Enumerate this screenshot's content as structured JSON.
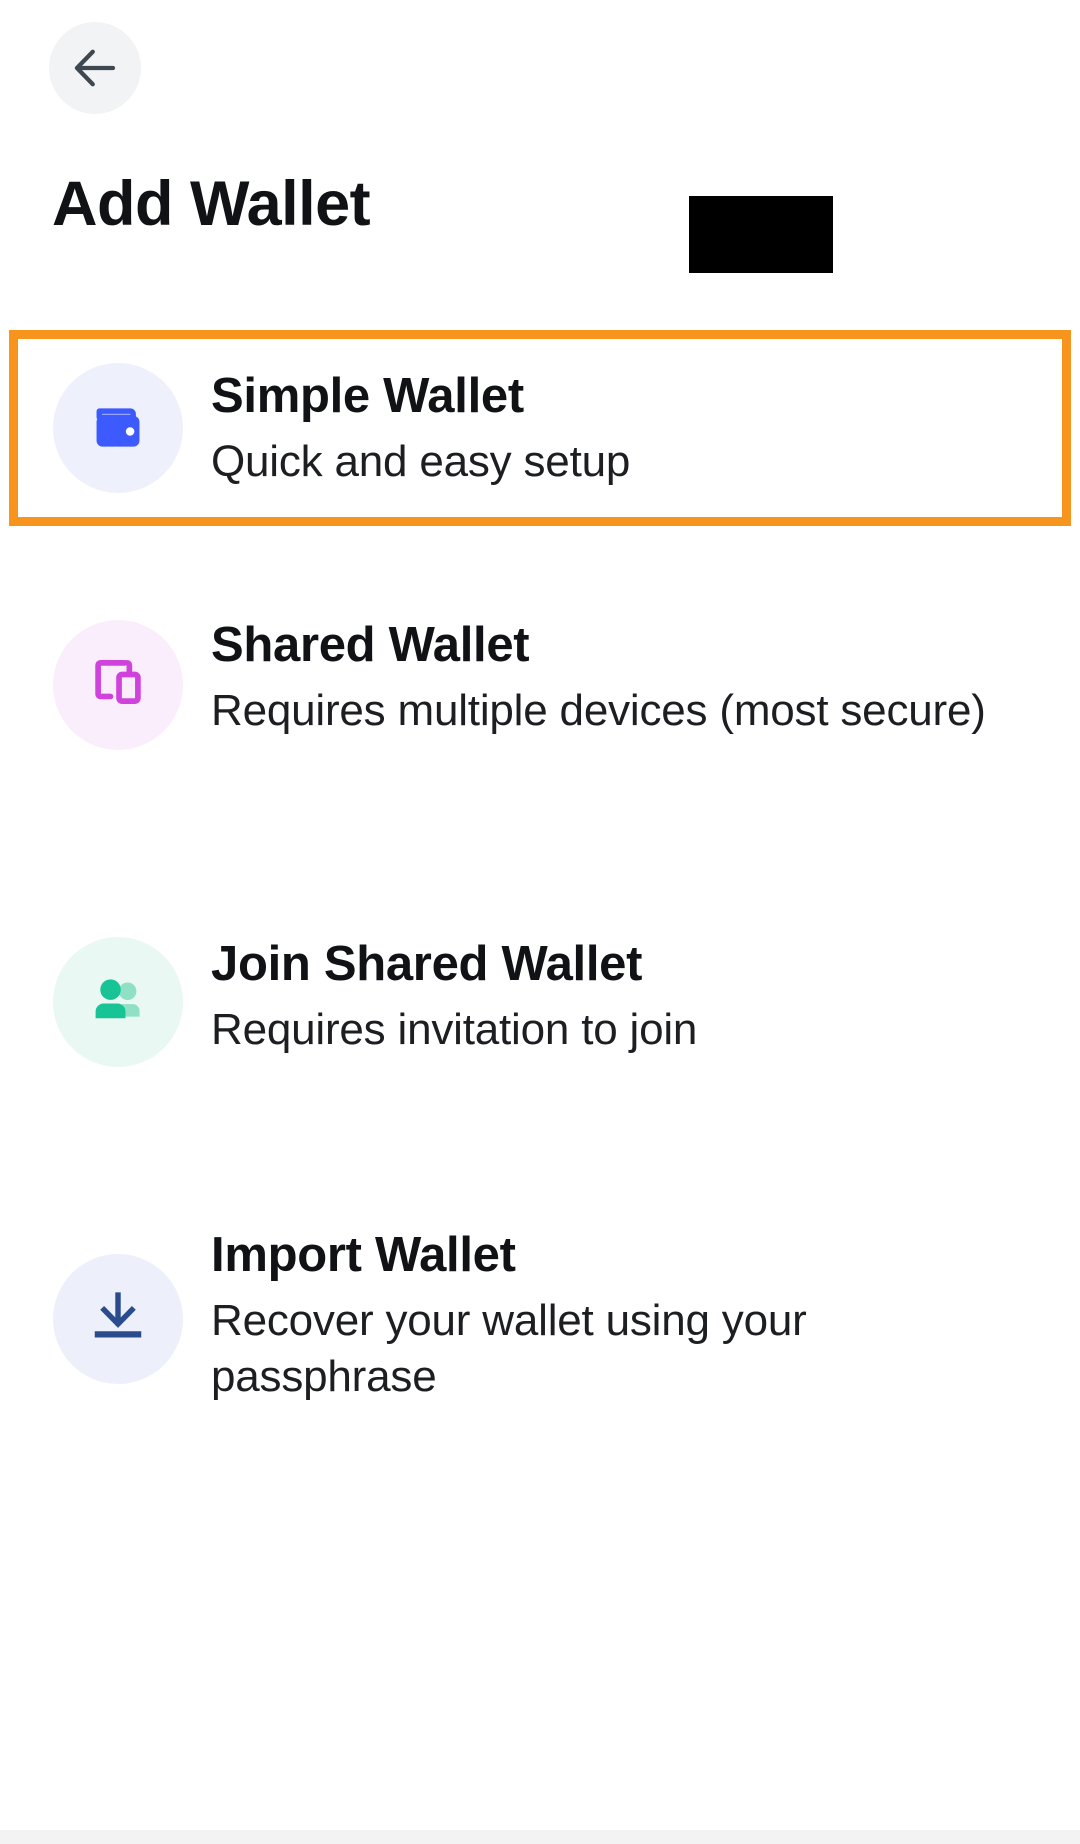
{
  "header": {
    "back_icon": "arrow-left-icon",
    "title": "Add Wallet",
    "redaction_label": ""
  },
  "colors": {
    "highlight_border": "#f7941d",
    "simple_icon": "#3d5afe",
    "simple_badge_bg": "#eef0fc",
    "shared_icon": "#cf43dc",
    "shared_badge_bg": "#fbeefc",
    "join_icon": "#18c496",
    "join_icon_light": "#8fe0c5",
    "join_badge_bg": "#e9f8f2",
    "import_icon": "#2a4b8d",
    "import_badge_bg": "#edf0fa",
    "back_button_bg": "#f2f3f4",
    "title_text": "#111215"
  },
  "options": [
    {
      "id": "simple-wallet",
      "title": "Simple Wallet",
      "subtitle": "Quick and easy setup",
      "icon": "wallet-icon",
      "highlighted": true
    },
    {
      "id": "shared-wallet",
      "title": "Shared Wallet",
      "subtitle": "Requires multiple devices (most secure)",
      "icon": "devices-icon",
      "highlighted": false
    },
    {
      "id": "join-shared-wallet",
      "title": "Join Shared Wallet",
      "subtitle": "Requires invitation to join",
      "icon": "people-icon",
      "highlighted": false
    },
    {
      "id": "import-wallet",
      "title": "Import Wallet",
      "subtitle": "Recover your wallet using your passphrase",
      "icon": "download-icon",
      "highlighted": false
    }
  ]
}
